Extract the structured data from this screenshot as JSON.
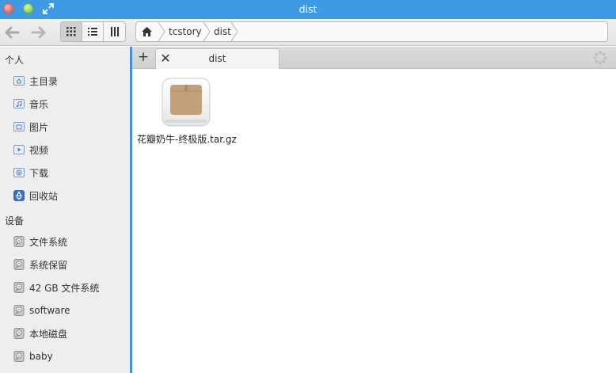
{
  "window": {
    "title": "dist"
  },
  "toolbar": {
    "icons": [
      "back-arrow-icon",
      "forward-arrow-icon",
      "grid-view-icon",
      "list-view-icon",
      "column-view-icon",
      "home-icon"
    ],
    "breadcrumbs": [
      "tcstory",
      "dist"
    ]
  },
  "sidebar": {
    "personal_heading": "个人",
    "personal_items": [
      {
        "label": "主目录",
        "icon": "home-folder-icon"
      },
      {
        "label": "音乐",
        "icon": "music-folder-icon"
      },
      {
        "label": "图片",
        "icon": "pictures-folder-icon"
      },
      {
        "label": "视频",
        "icon": "videos-folder-icon"
      },
      {
        "label": "下载",
        "icon": "downloads-folder-icon"
      },
      {
        "label": "回收站",
        "icon": "trash-icon"
      }
    ],
    "devices_heading": "设备",
    "device_items": [
      {
        "label": "文件系统",
        "icon": "drive-icon"
      },
      {
        "label": "系统保留",
        "icon": "drive-icon"
      },
      {
        "label": "42 GB 文件系统",
        "icon": "drive-icon"
      },
      {
        "label": "software",
        "icon": "drive-icon"
      },
      {
        "label": "本地磁盘",
        "icon": "drive-icon"
      },
      {
        "label": "baby",
        "icon": "drive-icon"
      }
    ]
  },
  "tabs": {
    "add_label": "+",
    "close_label": "✕",
    "active_tab_label": "dist"
  },
  "files": [
    {
      "name": "花瓣奶牛-终极版.tar.gz",
      "icon": "archive-package-icon"
    }
  ],
  "colors": {
    "accent": "#3d9ae3",
    "sidebar_edge": "#4a90d9"
  }
}
